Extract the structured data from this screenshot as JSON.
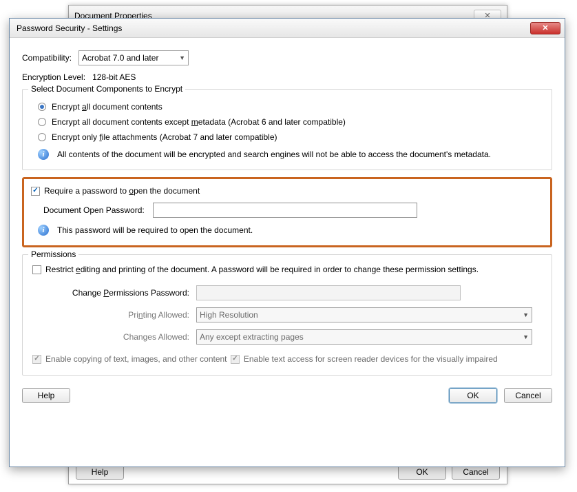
{
  "back": {
    "title": "Document Properties",
    "help": "Help",
    "ok": "OK",
    "cancel": "Cancel"
  },
  "front": {
    "title": "Password Security - Settings",
    "compat_label": "Compatibility:",
    "compat_value": "Acrobat 7.0 and later",
    "enc_label": "Encryption  Level:",
    "enc_value": "128-bit AES",
    "components_legend": "Select Document Components to Encrypt",
    "r1a": "Encrypt ",
    "r1b": "a",
    "r1c": "ll document contents",
    "r2a": "Encrypt all document contents except ",
    "r2b": "m",
    "r2c": "etadata (Acrobat 6 and later compatible)",
    "r3a": "Encrypt only ",
    "r3b": "f",
    "r3c": "ile attachments (Acrobat 7 and later compatible)",
    "enc_info": "All contents of the document will be encrypted and search engines will not be able to access the document's metadata.",
    "req_a": "Require a password to ",
    "req_b": "o",
    "req_c": "pen the document",
    "open_pw_label": "Document Open Password:",
    "open_pw_info": "This password will be required to open the document.",
    "perm_legend": "Permissions",
    "restrict_a": "Restrict ",
    "restrict_b": "e",
    "restrict_c": "diting and printing of the document. A password will be required in order to change these permission settings.",
    "change_pw_a": "Change ",
    "change_pw_b": "P",
    "change_pw_c": "ermissions Password:",
    "printing_a": "Pri",
    "printing_b": "n",
    "printing_c": "ting Allowed:",
    "printing_value": "High Resolution",
    "changes_a": "Chan",
    "changes_b": "g",
    "changes_c": "es Allowed:",
    "changes_value": "Any except extracting pages",
    "copy_label": "Enable copying of text, images, and other content",
    "reader_label": "Enable text access for screen reader devices for the visually impaired",
    "help": "Help",
    "ok": "OK",
    "cancel": "Cancel"
  }
}
